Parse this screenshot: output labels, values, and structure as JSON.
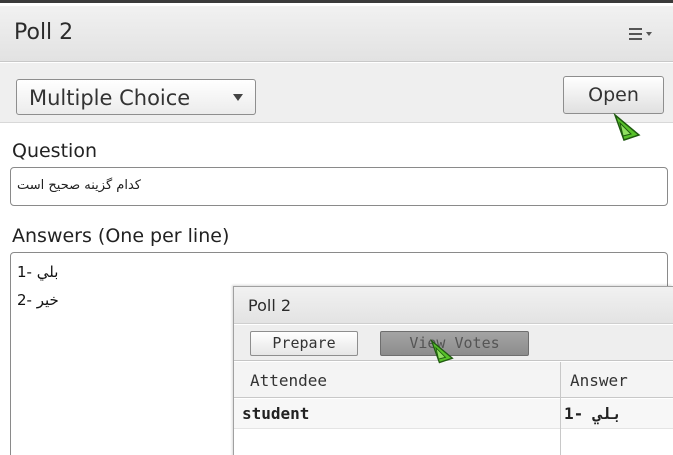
{
  "main_pod": {
    "title": "Poll 2",
    "type_select": {
      "selected": "Multiple Choice"
    },
    "open_button_label": "Open",
    "question_label": "Question",
    "question_text": "کدام گزینه صحیح است",
    "answers_label": "Answers (One per line)",
    "answers": [
      "1- بلي",
      "2- خير"
    ]
  },
  "votes_pod": {
    "title": "Poll 2",
    "prepare_label": "Prepare",
    "view_votes_label": "View Votes",
    "columns": [
      "Attendee",
      "Answer"
    ],
    "rows": [
      {
        "attendee": "student",
        "answer": "1- بلي"
      }
    ]
  },
  "icons": {
    "menu": "menu-icon",
    "dropdown": "chevron-down-icon",
    "cursor": "cursor-icon"
  },
  "colors": {
    "cursor_fill": "#58c22a",
    "view_votes_bg": "#999999"
  }
}
